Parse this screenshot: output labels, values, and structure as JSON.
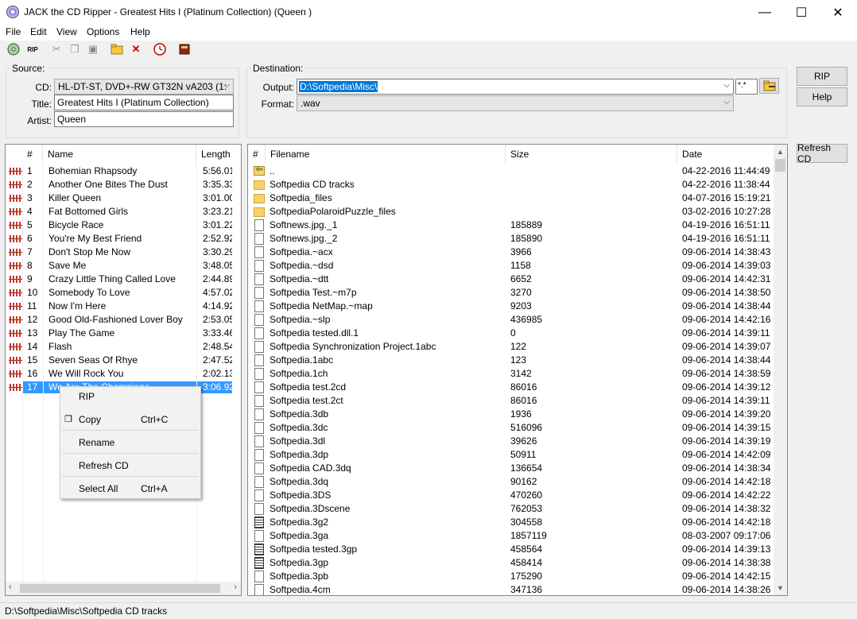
{
  "window": {
    "title": "JACK the CD Ripper - Greatest Hits I (Platinum  Collection) (Queen )",
    "controls": [
      "—",
      "☐",
      "✕"
    ]
  },
  "menu": [
    "File",
    "Edit",
    "View",
    "Options",
    "Help"
  ],
  "source": {
    "label": "Source:",
    "cd_label": "CD:",
    "cd_value": "HL-DT-ST, DVD+-RW GT32N    vA203 (1:",
    "title_label": "Title:",
    "title_value": "Greatest Hits I (Platinum  Collection)",
    "artist_label": "Artist:",
    "artist_value": "Queen"
  },
  "destination": {
    "label": "Destination:",
    "output_label": "Output:",
    "output_value": "D:\\Softpedia\\Misc\\",
    "mask_value": "*.*",
    "format_label": "Format:",
    "format_value": ".wav"
  },
  "buttons": {
    "rip": "RIP",
    "help": "Help",
    "refresh": "Refresh CD"
  },
  "tracks": {
    "headers": [
      "#",
      "Name",
      "Length"
    ],
    "rows": [
      {
        "n": "1",
        "name": "Bohemian Rhapsody",
        "len": "5:56.01"
      },
      {
        "n": "2",
        "name": "Another One Bites The Dust",
        "len": "3:35.33"
      },
      {
        "n": "3",
        "name": "Killer Queen",
        "len": "3:01.00"
      },
      {
        "n": "4",
        "name": "Fat Bottomed Girls",
        "len": "3:23.21"
      },
      {
        "n": "5",
        "name": "Bicycle Race",
        "len": "3:01.22"
      },
      {
        "n": "6",
        "name": "You're My Best Friend",
        "len": "2:52.92"
      },
      {
        "n": "7",
        "name": "Don't Stop Me Now",
        "len": "3:30.29"
      },
      {
        "n": "8",
        "name": "Save Me",
        "len": "3:48.05"
      },
      {
        "n": "9",
        "name": "Crazy Little Thing Called Love",
        "len": "2:44.89"
      },
      {
        "n": "10",
        "name": "Somebody To Love",
        "len": "4:57.02"
      },
      {
        "n": "11",
        "name": "Now I'm Here",
        "len": "4:14.92"
      },
      {
        "n": "12",
        "name": "Good Old-Fashioned Lover Boy",
        "len": "2:53.05"
      },
      {
        "n": "13",
        "name": "Play The Game",
        "len": "3:33.46"
      },
      {
        "n": "14",
        "name": "Flash",
        "len": "2:48.54"
      },
      {
        "n": "15",
        "name": "Seven Seas Of Rhye",
        "len": "2:47.52"
      },
      {
        "n": "16",
        "name": "We Will Rock You",
        "len": "2:02.13"
      },
      {
        "n": "17",
        "name": "We Are The Champions",
        "len": "3:06.92"
      }
    ]
  },
  "files": {
    "headers": [
      "#",
      "Filename",
      "Size",
      "Date"
    ],
    "rows": [
      {
        "icon": "folder-up",
        "name": "..",
        "size": "",
        "date": "04-22-2016 11:44:49"
      },
      {
        "icon": "folder",
        "name": "Softpedia CD tracks",
        "size": "",
        "date": "04-22-2016 11:38:44"
      },
      {
        "icon": "folder",
        "name": "Softpedia_files",
        "size": "",
        "date": "04-07-2016 15:19:21"
      },
      {
        "icon": "folder",
        "name": "SoftpediaPolaroidPuzzle_files",
        "size": "",
        "date": "03-02-2016 10:27:28"
      },
      {
        "icon": "doc",
        "name": "Softnews.jpg._1",
        "size": "185889",
        "date": "04-19-2016 16:51:11"
      },
      {
        "icon": "doc",
        "name": "Softnews.jpg._2",
        "size": "185890",
        "date": "04-19-2016 16:51:11"
      },
      {
        "icon": "doc",
        "name": "Softpedia.~acx",
        "size": "3966",
        "date": "09-06-2014 14:38:43"
      },
      {
        "icon": "doc",
        "name": "Softpedia.~dsd",
        "size": "1158",
        "date": "09-06-2014 14:39:03"
      },
      {
        "icon": "doc",
        "name": "Softpedia.~dtt",
        "size": "6652",
        "date": "09-06-2014 14:42:31"
      },
      {
        "icon": "doc",
        "name": "Softpedia Test.~m7p",
        "size": "3270",
        "date": "09-06-2014 14:38:50"
      },
      {
        "icon": "doc",
        "name": "Softpedia NetMap.~map",
        "size": "9203",
        "date": "09-06-2014 14:38:44"
      },
      {
        "icon": "doc",
        "name": "Softpedia.~slp",
        "size": "436985",
        "date": "09-06-2014 14:42:16"
      },
      {
        "icon": "doc",
        "name": "Softpedia tested.dll.1",
        "size": "0",
        "date": "09-06-2014 14:39:11"
      },
      {
        "icon": "doc",
        "name": "Softpedia Synchronization Project.1abc",
        "size": "122",
        "date": "09-06-2014 14:39:07"
      },
      {
        "icon": "doc",
        "name": "Softpedia.1abc",
        "size": "123",
        "date": "09-06-2014 14:38:44"
      },
      {
        "icon": "doc",
        "name": "Softpedia.1ch",
        "size": "3142",
        "date": "09-06-2014 14:38:59"
      },
      {
        "icon": "doc",
        "name": "Softpedia test.2cd",
        "size": "86016",
        "date": "09-06-2014 14:39:12"
      },
      {
        "icon": "doc",
        "name": "Softpedia test.2ct",
        "size": "86016",
        "date": "09-06-2014 14:39:11"
      },
      {
        "icon": "doc",
        "name": "Softpedia.3db",
        "size": "1936",
        "date": "09-06-2014 14:39:20"
      },
      {
        "icon": "doc",
        "name": "Softpedia.3dc",
        "size": "516096",
        "date": "09-06-2014 14:39:15"
      },
      {
        "icon": "doc",
        "name": "Softpedia.3dl",
        "size": "39626",
        "date": "09-06-2014 14:39:19"
      },
      {
        "icon": "doc",
        "name": "Softpedia.3dp",
        "size": "50911",
        "date": "09-06-2014 14:42:09"
      },
      {
        "icon": "doc",
        "name": "Softpedia CAD.3dq",
        "size": "136654",
        "date": "09-06-2014 14:38:34"
      },
      {
        "icon": "doc",
        "name": "Softpedia.3dq",
        "size": "90162",
        "date": "09-06-2014 14:42:18"
      },
      {
        "icon": "doc",
        "name": "Softpedia.3DS",
        "size": "470260",
        "date": "09-06-2014 14:42:22"
      },
      {
        "icon": "doc",
        "name": "Softpedia.3Dscene",
        "size": "762053",
        "date": "09-06-2014 14:38:32"
      },
      {
        "icon": "doc2",
        "name": "Softpedia.3g2",
        "size": "304558",
        "date": "09-06-2014 14:42:18"
      },
      {
        "icon": "doc",
        "name": "Softpedia.3ga",
        "size": "1857119",
        "date": "08-03-2007 09:17:06"
      },
      {
        "icon": "doc2",
        "name": "Softpedia tested.3gp",
        "size": "458564",
        "date": "09-06-2014 14:39:13"
      },
      {
        "icon": "doc2",
        "name": "Softpedia.3gp",
        "size": "458414",
        "date": "09-06-2014 14:38:38"
      },
      {
        "icon": "doc",
        "name": "Softpedia.3pb",
        "size": "175290",
        "date": "09-06-2014 14:42:15"
      },
      {
        "icon": "doc",
        "name": "Softpedia.4cm",
        "size": "347136",
        "date": "09-06-2014 14:38:26"
      }
    ]
  },
  "context_menu": {
    "rip": "RIP",
    "copy": "Copy",
    "copy_key": "Ctrl+C",
    "rename": "Rename",
    "refresh": "Refresh CD",
    "select_all": "Select All",
    "select_all_key": "Ctrl+A"
  },
  "status": "D:\\Softpedia\\Misc\\Softpedia CD tracks"
}
